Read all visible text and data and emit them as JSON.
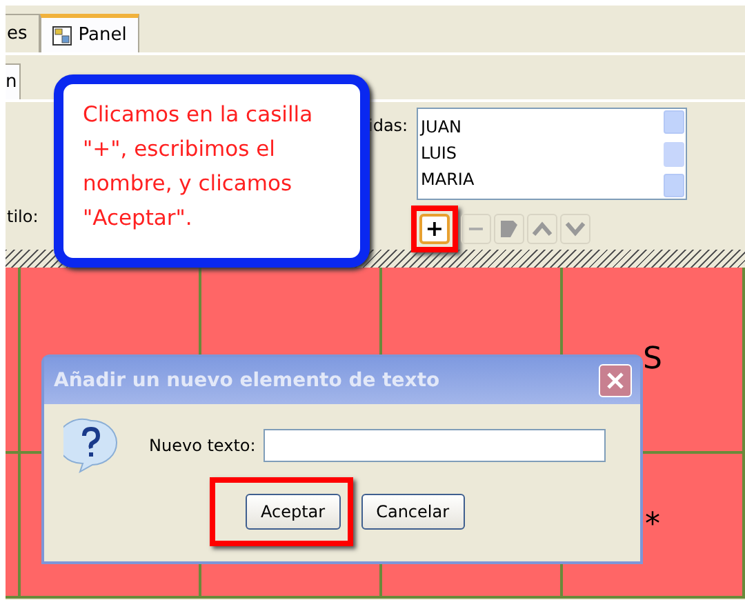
{
  "tabs": [
    {
      "label": "es",
      "selected": false
    },
    {
      "label": "Panel",
      "selected": true
    }
  ],
  "subtabs": [
    {
      "label": "n",
      "selected": true
    }
  ],
  "list_label": "idas:",
  "list_items": [
    "JUAN",
    "LUIS",
    "MARIA"
  ],
  "style_label": "tilo:",
  "list_buttons": [
    {
      "kind": "add",
      "symbol": "+",
      "disabled": false,
      "highlighted": true
    },
    {
      "kind": "remove",
      "symbol": "−",
      "disabled": true,
      "highlighted": false
    },
    {
      "kind": "edit",
      "disabled": true,
      "highlighted": false
    },
    {
      "kind": "up",
      "disabled": true,
      "highlighted": false
    },
    {
      "kind": "down",
      "disabled": true,
      "highlighted": false
    }
  ],
  "callout": {
    "text": "Clicamos en la casilla \"+\", escribimos el nombre, y clicamos \"Aceptar\"."
  },
  "board": {
    "rows": [
      [
        null,
        null,
        null,
        null,
        "S"
      ],
      [
        null,
        null,
        null,
        null,
        "*"
      ]
    ]
  },
  "dialog": {
    "title": "Añadir un nuevo elemento de texto",
    "field_label": "Nuevo texto:",
    "buttons": [
      {
        "label": "Aceptar",
        "highlighted": true
      },
      {
        "label": "Cancelar",
        "highlighted": false
      }
    ]
  }
}
